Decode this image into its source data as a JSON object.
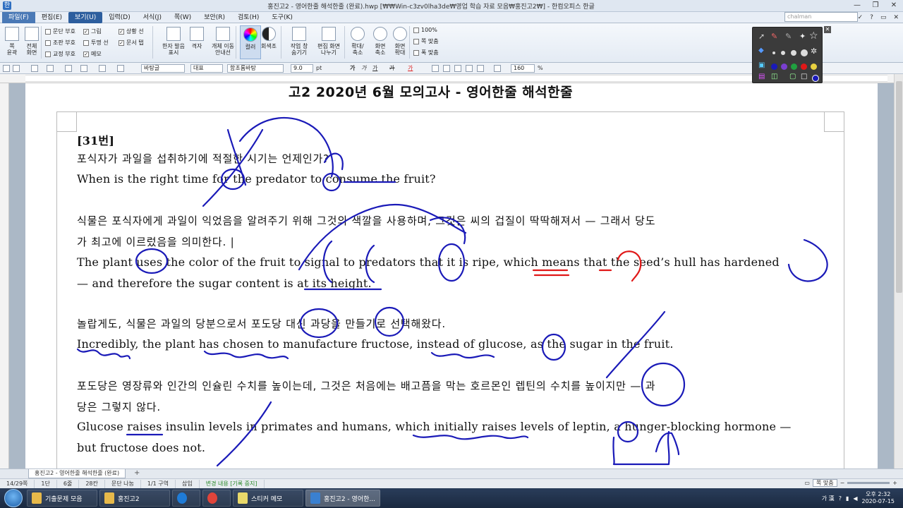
{
  "window": {
    "title": "홍진고2 - 영어한줄 해석한줄 (완료).hwp [₩₩Win-c3zv0lha3de₩영업 학습 자료 모음₩홍진고2₩] - 한컴오피스 한글",
    "min": "—",
    "max": "❐",
    "close": "✕"
  },
  "menu": {
    "items": [
      "파일(F)",
      "편집(E)",
      "보기(U)",
      "입력(D)",
      "서식(J)",
      "쪽(W)",
      "보안(R)",
      "검토(H)",
      "도구(K)"
    ],
    "active_index": 2,
    "user": "chalman",
    "right_icons": [
      "✓",
      "?",
      "▭",
      "✕"
    ]
  },
  "ribbon": {
    "buttons": [
      {
        "label": "쪽\n윤곽",
        "icon": "page-outline-icon"
      },
      {
        "label": "전체\n화면",
        "icon": "fullscreen-icon"
      },
      {
        "label": "한자 발음\n표시",
        "icon": "hanja-icon"
      },
      {
        "label": "격자",
        "icon": "grid-icon"
      },
      {
        "label": "개체 이동\n안내선",
        "icon": "guide-icon"
      },
      {
        "label": "컬러",
        "icon": "color-icon"
      },
      {
        "label": "회색조",
        "icon": "grayscale-icon"
      },
      {
        "label": "작업 창\n숨기기",
        "icon": "taskpane-icon"
      },
      {
        "label": "편집 화면\n나누기",
        "icon": "split-icon"
      },
      {
        "label": "확대/\n축소",
        "icon": "zoom-icon"
      },
      {
        "label": "화면\n축소",
        "icon": "zoom-out-icon"
      },
      {
        "label": "화면\n확대",
        "icon": "zoom-in-icon"
      }
    ],
    "checks_col1": [
      {
        "label": "문단 부호",
        "checked": false
      },
      {
        "label": "조판 부호",
        "checked": false
      },
      {
        "label": "교정 부호",
        "checked": false
      }
    ],
    "checks_col2": [
      {
        "label": "그림",
        "checked": true
      },
      {
        "label": "투명 선",
        "checked": false
      },
      {
        "label": "메모",
        "checked": true
      }
    ],
    "checks_col3": [
      {
        "label": "상황 선",
        "checked": true
      },
      {
        "label": "문서 탭",
        "checked": true
      }
    ],
    "zoom_options": [
      "100%",
      "쪽 맞춤",
      "폭 맞춤"
    ]
  },
  "formatbar": {
    "style": "바탕글",
    "lang": "대표",
    "font": "함초롬바탕",
    "size": "9.0",
    "unit": "pt",
    "bold": "가",
    "italic": "가",
    "underline": "가",
    "strike": "가",
    "color": "가",
    "zoom": "160",
    "zoom_unit": "%"
  },
  "document": {
    "title": "고2 2020년 6월 모의고사 - 영어한줄 해석한줄",
    "number": "[31번]",
    "lines": [
      {
        "kr": true,
        "text": "포식자가 과일을 섭취하기에 적절한 시기는 언제인가?"
      },
      {
        "kr": false,
        "text": "When is the right time for the predator to consume the fruit?"
      },
      {
        "kr": true,
        "text": "식물은 포식자에게 과일이 익었음을 알려주기 위해 그것의 색깔을 사용하며, 그것은 씨의 겁질이 딱딱해져서 — 그래서 당도"
      },
      {
        "kr": true,
        "text": "가 최고에 이르렀음을 의미한다. |"
      },
      {
        "kr": false,
        "text": "The plant uses the color of the fruit to signal to predators that it is ripe, which means that the seed’s hull has hardened"
      },
      {
        "kr": false,
        "text": "— and therefore the sugar content is at its height."
      },
      {
        "kr": true,
        "text": "놀랍게도, 식물은 과일의 당분으로서 포도당 대신 과당을 만들기로 선택해왔다."
      },
      {
        "kr": false,
        "text": "Incredibly, the plant has chosen to manufacture fructose, instead of glucose, as the sugar in the fruit."
      },
      {
        "kr": true,
        "text": "포도당은 영장류와 인간의 인슐린 수치를 높이는데, 그것은 처음에는 배고픔을 막는 호르몬인 렙틴의 수치를 높이지만 — 과"
      },
      {
        "kr": true,
        "text": "당은 그렇지 않다."
      },
      {
        "kr": false,
        "text": "Glucose raises insulin levels in primates and humans, which initially raises levels of leptin, a hunger-blocking hormone —"
      },
      {
        "kr": false,
        "text": "but fructose does not."
      }
    ]
  },
  "tabs": {
    "current": "홍진고2 - 영어한줄 해석한줄 (완료)",
    "add": "+"
  },
  "status": {
    "items": [
      "14/29쪽",
      "1단",
      "6줄",
      "28칸",
      "문단 나눔",
      "1/1 구역",
      "삽입"
    ],
    "track": "변경 내용 [기록 중지]",
    "zoom_mode": "쪽 맞춤",
    "zoom_minus": "−",
    "zoom_plus": "+"
  },
  "taskbar": {
    "items": [
      {
        "label": "기출문제 모음",
        "color": "#e7b94a"
      },
      {
        "label": "홍진고2",
        "color": "#e7b94a"
      },
      {
        "label": "",
        "color": "#1f7bd6"
      },
      {
        "label": "",
        "color": "#e0443a"
      },
      {
        "label": "스티커 메모",
        "color": "#e9d96a"
      },
      {
        "label": "홍진고2 - 영어한...",
        "color": "#3a80d0"
      }
    ],
    "ime": "가 漢",
    "time": "오후 2:32",
    "date": "2020-07-15"
  },
  "colors": {
    "ink_blue": "#1a1ab8",
    "ink_red": "#e01818",
    "menu_blue": "#2d5e9e"
  }
}
